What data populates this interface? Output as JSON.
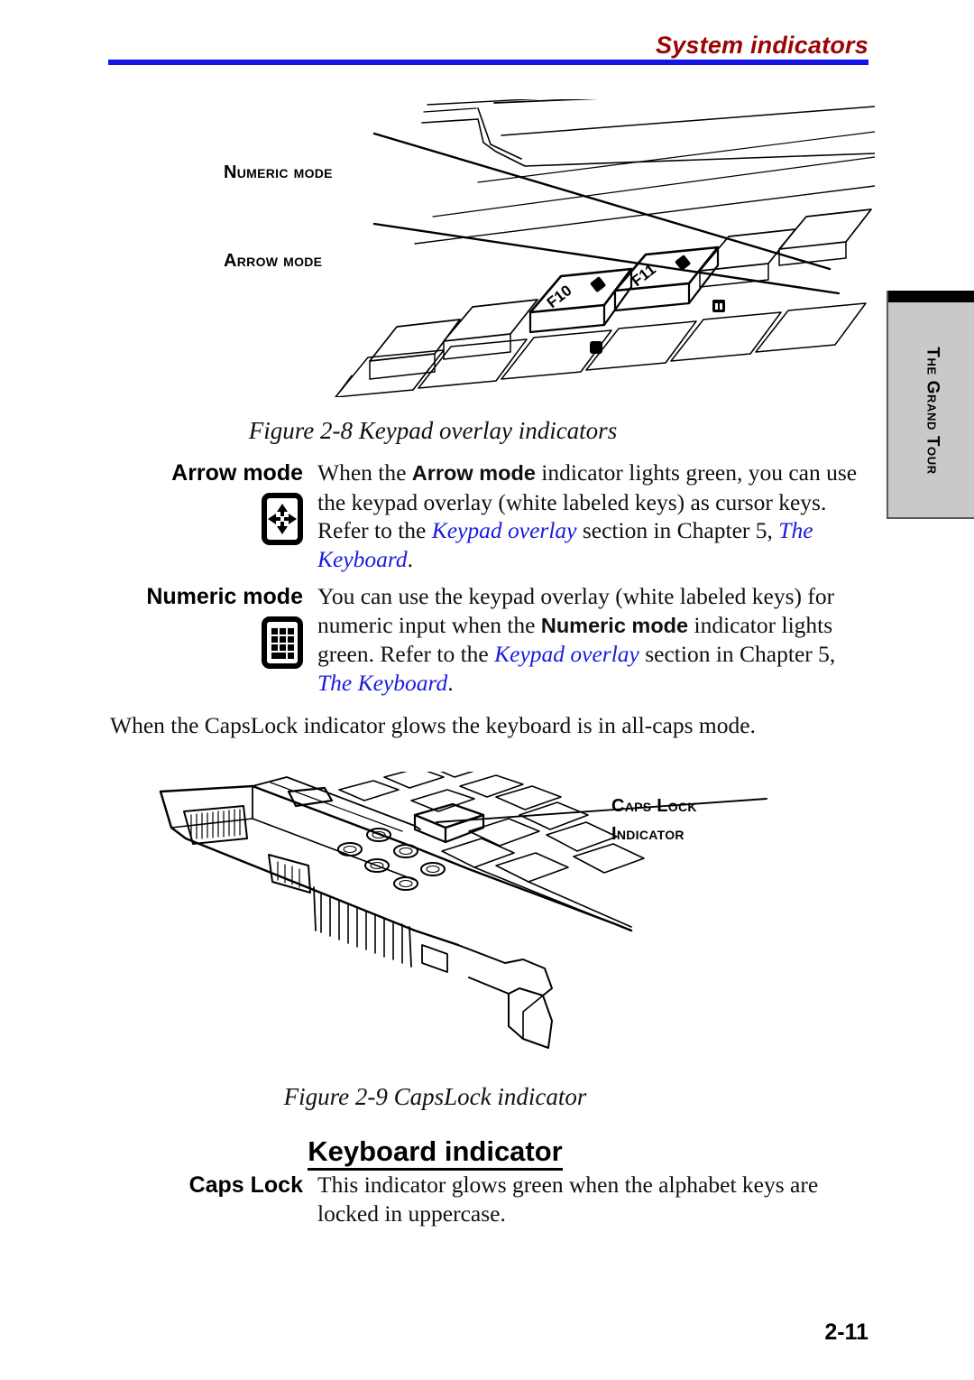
{
  "header": {
    "title": "System indicators",
    "rule_color": "#1414e6",
    "title_color": "#9c0404"
  },
  "side_tab": {
    "label": "The Grand Tour",
    "background": "#c9c9c9",
    "bar_color": "#000000"
  },
  "figures": {
    "keypad_overlay": {
      "caption": "Figure 2-8 Keypad overlay indicators",
      "callouts": [
        {
          "name": "numeric-mode",
          "label": "Numeric mode"
        },
        {
          "name": "arrow-mode",
          "label": "Arrow mode"
        }
      ],
      "key_labels": [
        "F10",
        "F11"
      ]
    },
    "capslock": {
      "caption": "Figure 2-9 CapsLock indicator",
      "callout_line1": "Caps Lock",
      "callout_line2": "Indicator"
    }
  },
  "mode_definitions": [
    {
      "term": "Arrow mode",
      "icon": "arrow-mode-icon",
      "desc_parts": [
        {
          "type": "text",
          "value": "When the "
        },
        {
          "type": "bold",
          "value": "Arrow mode"
        },
        {
          "type": "text",
          "value": " indicator lights green, you can use the keypad overlay (white labeled keys) as cursor keys. Refer to the "
        },
        {
          "type": "xref",
          "value": "Keypad overlay"
        },
        {
          "type": "text",
          "value": " section in Chapter 5, "
        },
        {
          "type": "xref",
          "value": "The Keyboard"
        },
        {
          "type": "text",
          "value": "."
        }
      ],
      "desc_plain": "When the Arrow mode indicator lights green, you can use the keypad overlay (white labeled keys) as cursor keys. Refer to the Keypad overlay section in Chapter 5, The Keyboard."
    },
    {
      "term": "Numeric mode",
      "icon": "numeric-mode-icon",
      "desc_parts": [
        {
          "type": "text",
          "value": "You can use the keypad overlay (white labeled keys) for numeric input when the "
        },
        {
          "type": "bold",
          "value": "Numeric mode"
        },
        {
          "type": "text",
          "value": " indicator lights green. Refer to the "
        },
        {
          "type": "xref",
          "value": "Keypad overlay"
        },
        {
          "type": "text",
          "value": " section in Chapter 5, "
        },
        {
          "type": "xref",
          "value": "The Keyboard"
        },
        {
          "type": "text",
          "value": "."
        }
      ],
      "desc_plain": "You can use the keypad overlay (white labeled keys) for numeric input when the Numeric mode indicator lights green. Refer to the Keypad overlay section in Chapter 5, The Keyboard."
    }
  ],
  "body": {
    "capslock_paragraph": "When the CapsLock indicator glows the keyboard is in all-caps mode."
  },
  "section": {
    "heading": "Keyboard indicator",
    "definition": {
      "term": "Caps Lock",
      "desc": "This indicator glows green when the alphabet keys are locked in uppercase."
    }
  },
  "footer": {
    "page_number": "2-11"
  },
  "colors": {
    "link_blue": "#1a1ae0",
    "heading_red": "#9c0404",
    "rule_blue": "#1414e6",
    "tab_gray": "#c9c9c9"
  }
}
